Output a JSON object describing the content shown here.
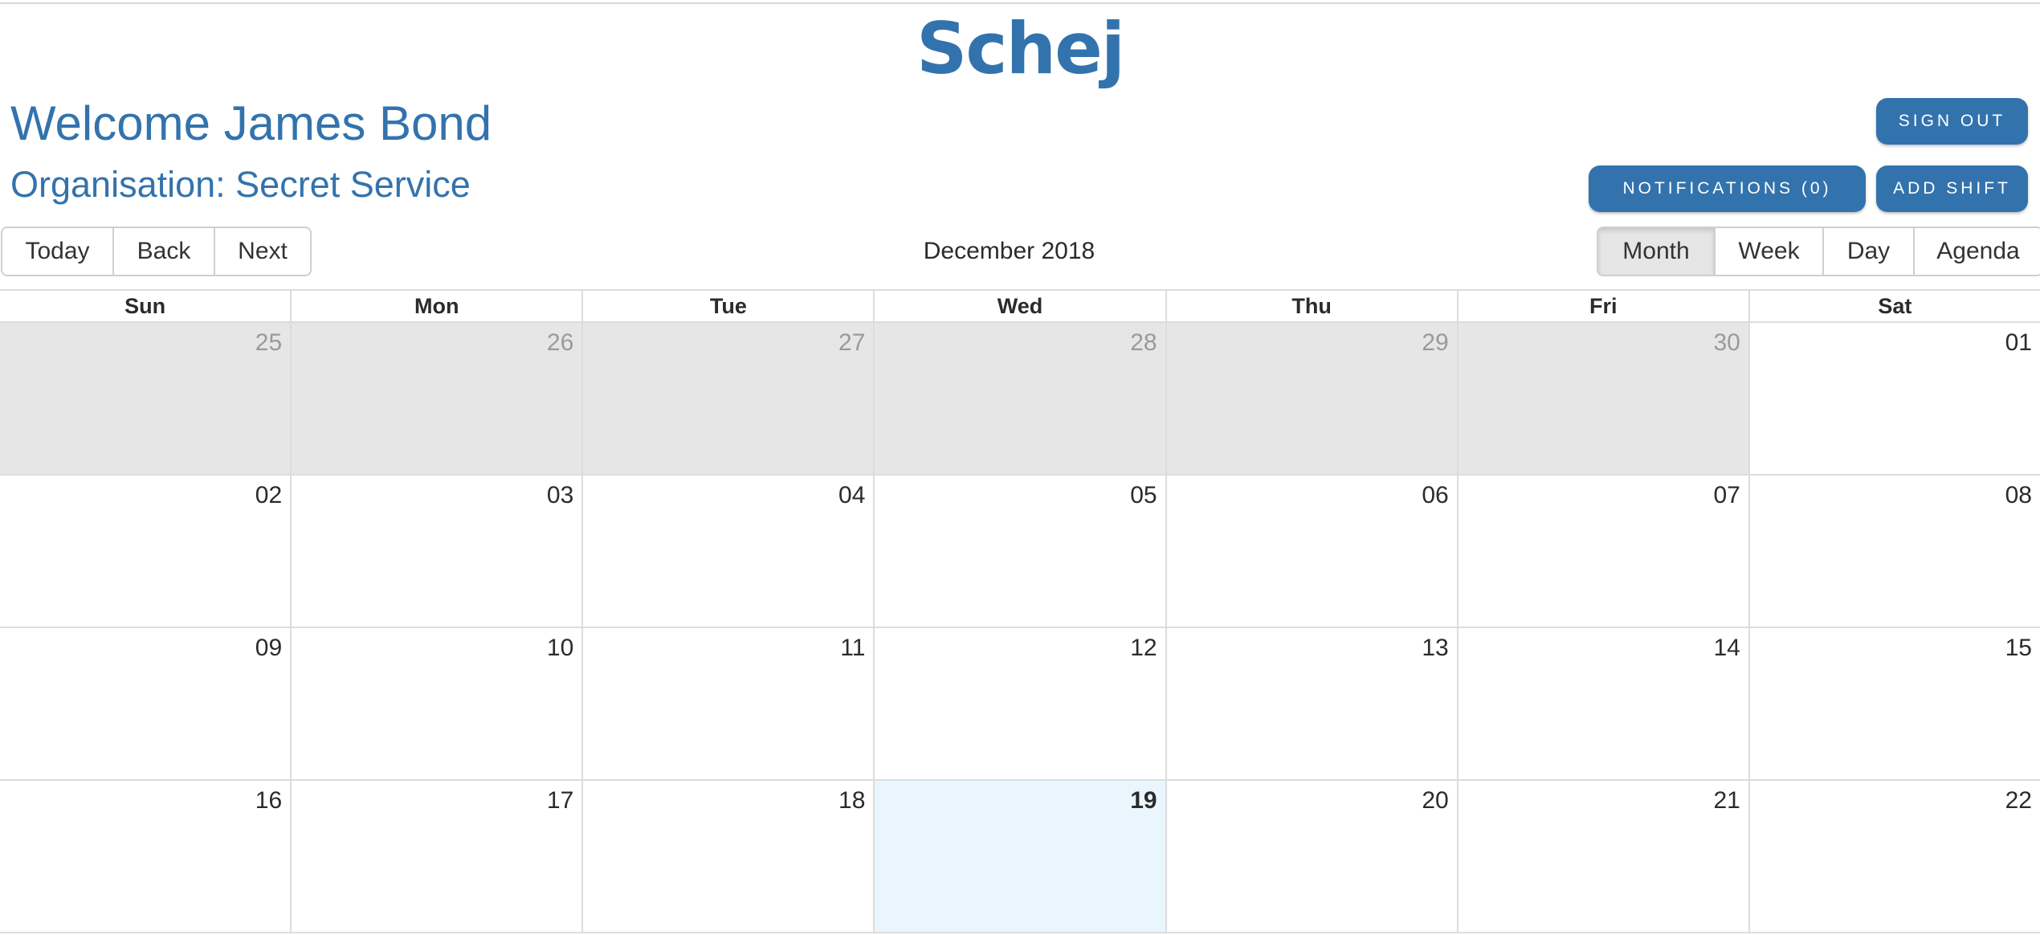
{
  "app": {
    "logo": "Schej",
    "brand_color": "#3373ad"
  },
  "header": {
    "welcome": "Welcome James Bond",
    "organisation": "Organisation: Secret Service",
    "sign_out": "SIGN OUT",
    "notifications": "NOTIFICATIONS (0)",
    "add_shift": "ADD SHIFT"
  },
  "toolbar": {
    "nav": [
      "Today",
      "Back",
      "Next"
    ],
    "month_label": "December 2018",
    "views": [
      "Month",
      "Week",
      "Day",
      "Agenda"
    ],
    "active_view": "Month"
  },
  "calendar": {
    "weekdays": [
      "Sun",
      "Mon",
      "Tue",
      "Wed",
      "Thu",
      "Fri",
      "Sat"
    ],
    "weeks": [
      [
        {
          "label": "25",
          "off": true
        },
        {
          "label": "26",
          "off": true
        },
        {
          "label": "27",
          "off": true
        },
        {
          "label": "28",
          "off": true
        },
        {
          "label": "29",
          "off": true
        },
        {
          "label": "30",
          "off": true
        },
        {
          "label": "01",
          "off": false
        }
      ],
      [
        {
          "label": "02",
          "off": false
        },
        {
          "label": "03",
          "off": false
        },
        {
          "label": "04",
          "off": false
        },
        {
          "label": "05",
          "off": false
        },
        {
          "label": "06",
          "off": false
        },
        {
          "label": "07",
          "off": false
        },
        {
          "label": "08",
          "off": false
        }
      ],
      [
        {
          "label": "09",
          "off": false
        },
        {
          "label": "10",
          "off": false
        },
        {
          "label": "11",
          "off": false
        },
        {
          "label": "12",
          "off": false
        },
        {
          "label": "13",
          "off": false
        },
        {
          "label": "14",
          "off": false
        },
        {
          "label": "15",
          "off": false
        }
      ],
      [
        {
          "label": "16",
          "off": false
        },
        {
          "label": "17",
          "off": false
        },
        {
          "label": "18",
          "off": false
        },
        {
          "label": "19",
          "off": false,
          "today": true
        },
        {
          "label": "20",
          "off": false
        },
        {
          "label": "21",
          "off": false
        },
        {
          "label": "22",
          "off": false
        }
      ]
    ],
    "colors": {
      "off_range": "#e6e6e6",
      "today": "#eaf6fe"
    }
  }
}
